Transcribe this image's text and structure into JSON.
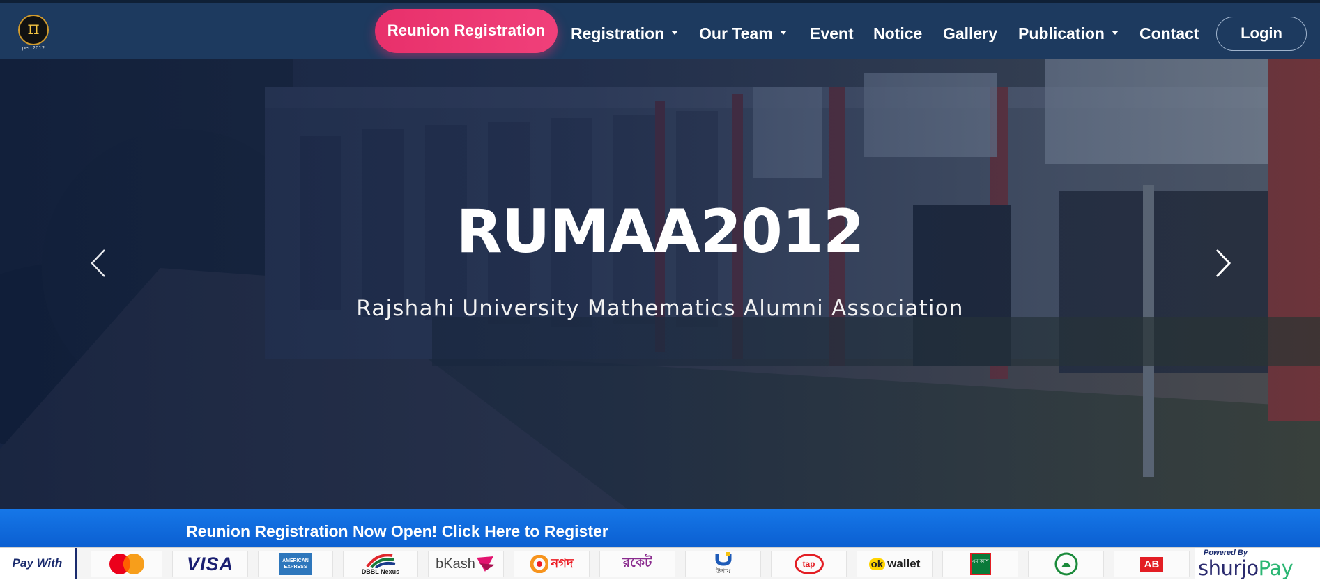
{
  "navbar": {
    "logo_glyph": "π",
    "logo_caption": "pec 2012",
    "reunion_button": "Reunion Registration",
    "items": [
      {
        "label": "Registration",
        "dropdown": true
      },
      {
        "label": "Our Team",
        "dropdown": true
      },
      {
        "label": "Event",
        "dropdown": false
      },
      {
        "label": "Notice",
        "dropdown": false
      },
      {
        "label": "Gallery",
        "dropdown": false
      },
      {
        "label": "Publication",
        "dropdown": true
      },
      {
        "label": "Contact",
        "dropdown": false
      }
    ],
    "login_button": "Login",
    "colors": {
      "background": "#1d3a5f",
      "accent": "#e8306b"
    }
  },
  "hero": {
    "title": "RUMAA2012",
    "subtitle": "Rajshahi University Mathematics Alumni Association",
    "prev_icon": "chevron-left-icon",
    "next_icon": "chevron-right-icon"
  },
  "banner": {
    "text": "Reunion Registration Now Open! Click Here to Register",
    "color": "#0b5fd1"
  },
  "payment": {
    "label": "Pay With",
    "methods": [
      {
        "name": "mastercard",
        "text": ""
      },
      {
        "name": "visa",
        "text": "VISA"
      },
      {
        "name": "american-express",
        "text": "AMERICAN EXPRESS"
      },
      {
        "name": "dbbl-nexus",
        "text": "DBBL Nexus"
      },
      {
        "name": "bkash",
        "text": "bKash"
      },
      {
        "name": "nagad",
        "text": "নগদ"
      },
      {
        "name": "rocket",
        "text": "রকেট"
      },
      {
        "name": "upay",
        "text": "উপায়"
      },
      {
        "name": "tap",
        "text": "tap"
      },
      {
        "name": "ok-wallet",
        "text": "wallet"
      },
      {
        "name": "mcash",
        "text": "এম ক্যাশ"
      },
      {
        "name": "islami-bank",
        "text": ""
      },
      {
        "name": "ab-bank",
        "text": "AB"
      }
    ],
    "powered_by_label": "Powered By",
    "powered_by_brand": "shurjo",
    "powered_by_brand_suffix": "Pay"
  }
}
